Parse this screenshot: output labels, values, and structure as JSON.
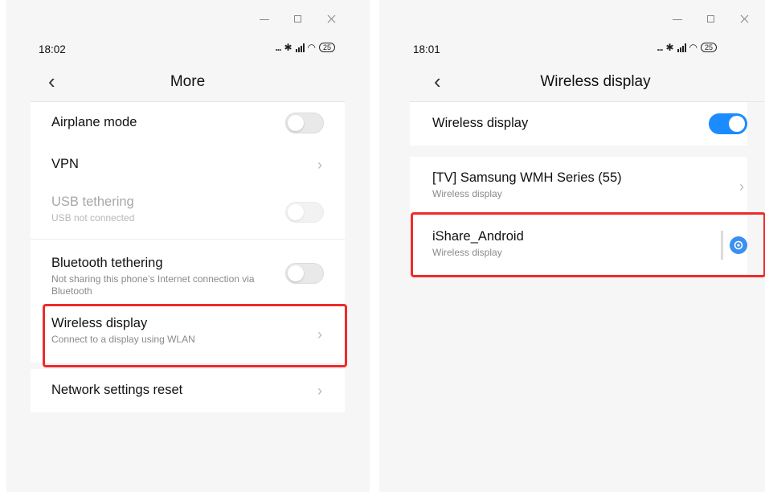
{
  "left": {
    "status": {
      "time": "18:02",
      "icons_text": "...",
      "battery": "25"
    },
    "title": "More",
    "items": [
      {
        "title": "Airplane mode",
        "type": "toggle",
        "state": "off"
      },
      {
        "title": "VPN",
        "type": "chevron"
      },
      {
        "title": "USB tethering",
        "subtitle": "USB not connected",
        "type": "toggle",
        "state": "disabled"
      },
      {
        "title": "Bluetooth tethering",
        "subtitle": "Not sharing this phone’s Internet connection via Bluetooth",
        "type": "toggle",
        "state": "off"
      },
      {
        "title": "Wireless display",
        "subtitle": "Connect to a display using WLAN",
        "type": "chevron",
        "highlighted": true
      },
      {
        "title": "Network settings reset",
        "type": "chevron"
      }
    ]
  },
  "right": {
    "status": {
      "time": "18:01",
      "icons_text": "...",
      "battery": "25"
    },
    "title": "Wireless display",
    "toggle_item": {
      "title": "Wireless display",
      "state": "on"
    },
    "devices": [
      {
        "title": "[TV] Samsung WMH Series (55)",
        "subtitle": "Wireless display",
        "type": "chevron"
      },
      {
        "title": "iShare_Android",
        "subtitle": "Wireless display",
        "type": "settings",
        "highlighted": true
      }
    ]
  },
  "colors": {
    "accent": "#1a8cff",
    "highlight": "#ef2b2b",
    "settings_icon": "#3a8ff0"
  },
  "icons": {
    "back": "chevron-left-icon",
    "forward": "chevron-right-icon",
    "gear": "gear-icon",
    "bluetooth": "bluetooth-icon",
    "wifi": "wifi-icon"
  }
}
